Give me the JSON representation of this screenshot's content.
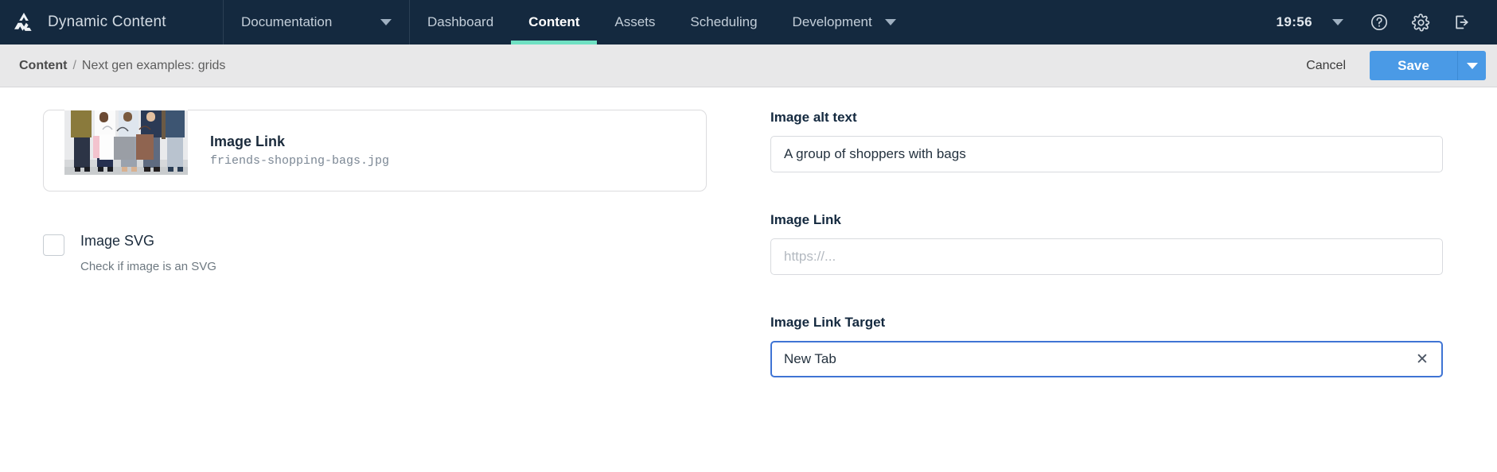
{
  "topnav": {
    "logo_icon": "amplience-triangle-logo",
    "brand": "Dynamic Content",
    "items": [
      {
        "label": "Documentation",
        "icon": "chevron-down-icon",
        "active": false
      },
      {
        "label": "Dashboard",
        "active": false
      },
      {
        "label": "Content",
        "active": true
      },
      {
        "label": "Assets",
        "active": false
      },
      {
        "label": "Scheduling",
        "active": false
      },
      {
        "label": "Development",
        "icon": "chevron-down-icon",
        "active": false
      }
    ],
    "clock": "19:56",
    "clock_caret_icon": "chevron-down-icon",
    "help_icon": "help-circle-icon",
    "settings_icon": "gear-icon",
    "logout_icon": "logout-icon",
    "bg_color": "#14293f",
    "active_underline_color": "#6fe0c2"
  },
  "subbar": {
    "breadcrumb_root": "Content",
    "breadcrumb_separator": "/",
    "breadcrumb_leaf": "Next gen examples: grids",
    "cancel_label": "Cancel",
    "save_label": "Save",
    "save_caret_icon": "chevron-down-icon",
    "save_color": "#4a9ae6"
  },
  "left_panel": {
    "image_card": {
      "thumbnail_alt": "group-of-shoppers-with-bags-thumbnail",
      "title": "Image Link",
      "filename": "friends-shopping-bags.jpg"
    },
    "svg_checkbox": {
      "checked": false,
      "label": "Image SVG",
      "help": "Check if image is an SVG"
    }
  },
  "right_panel": {
    "fields": [
      {
        "label": "Image alt text",
        "value": "A group of shoppers with bags",
        "placeholder": "",
        "focused": false,
        "clearable": false
      },
      {
        "label": "Image Link",
        "value": "",
        "placeholder": "https://...",
        "focused": false,
        "clearable": false
      },
      {
        "label": "Image Link Target",
        "value": "New Tab",
        "placeholder": "",
        "focused": true,
        "clearable": true,
        "clear_icon": "close-x-icon"
      }
    ]
  }
}
